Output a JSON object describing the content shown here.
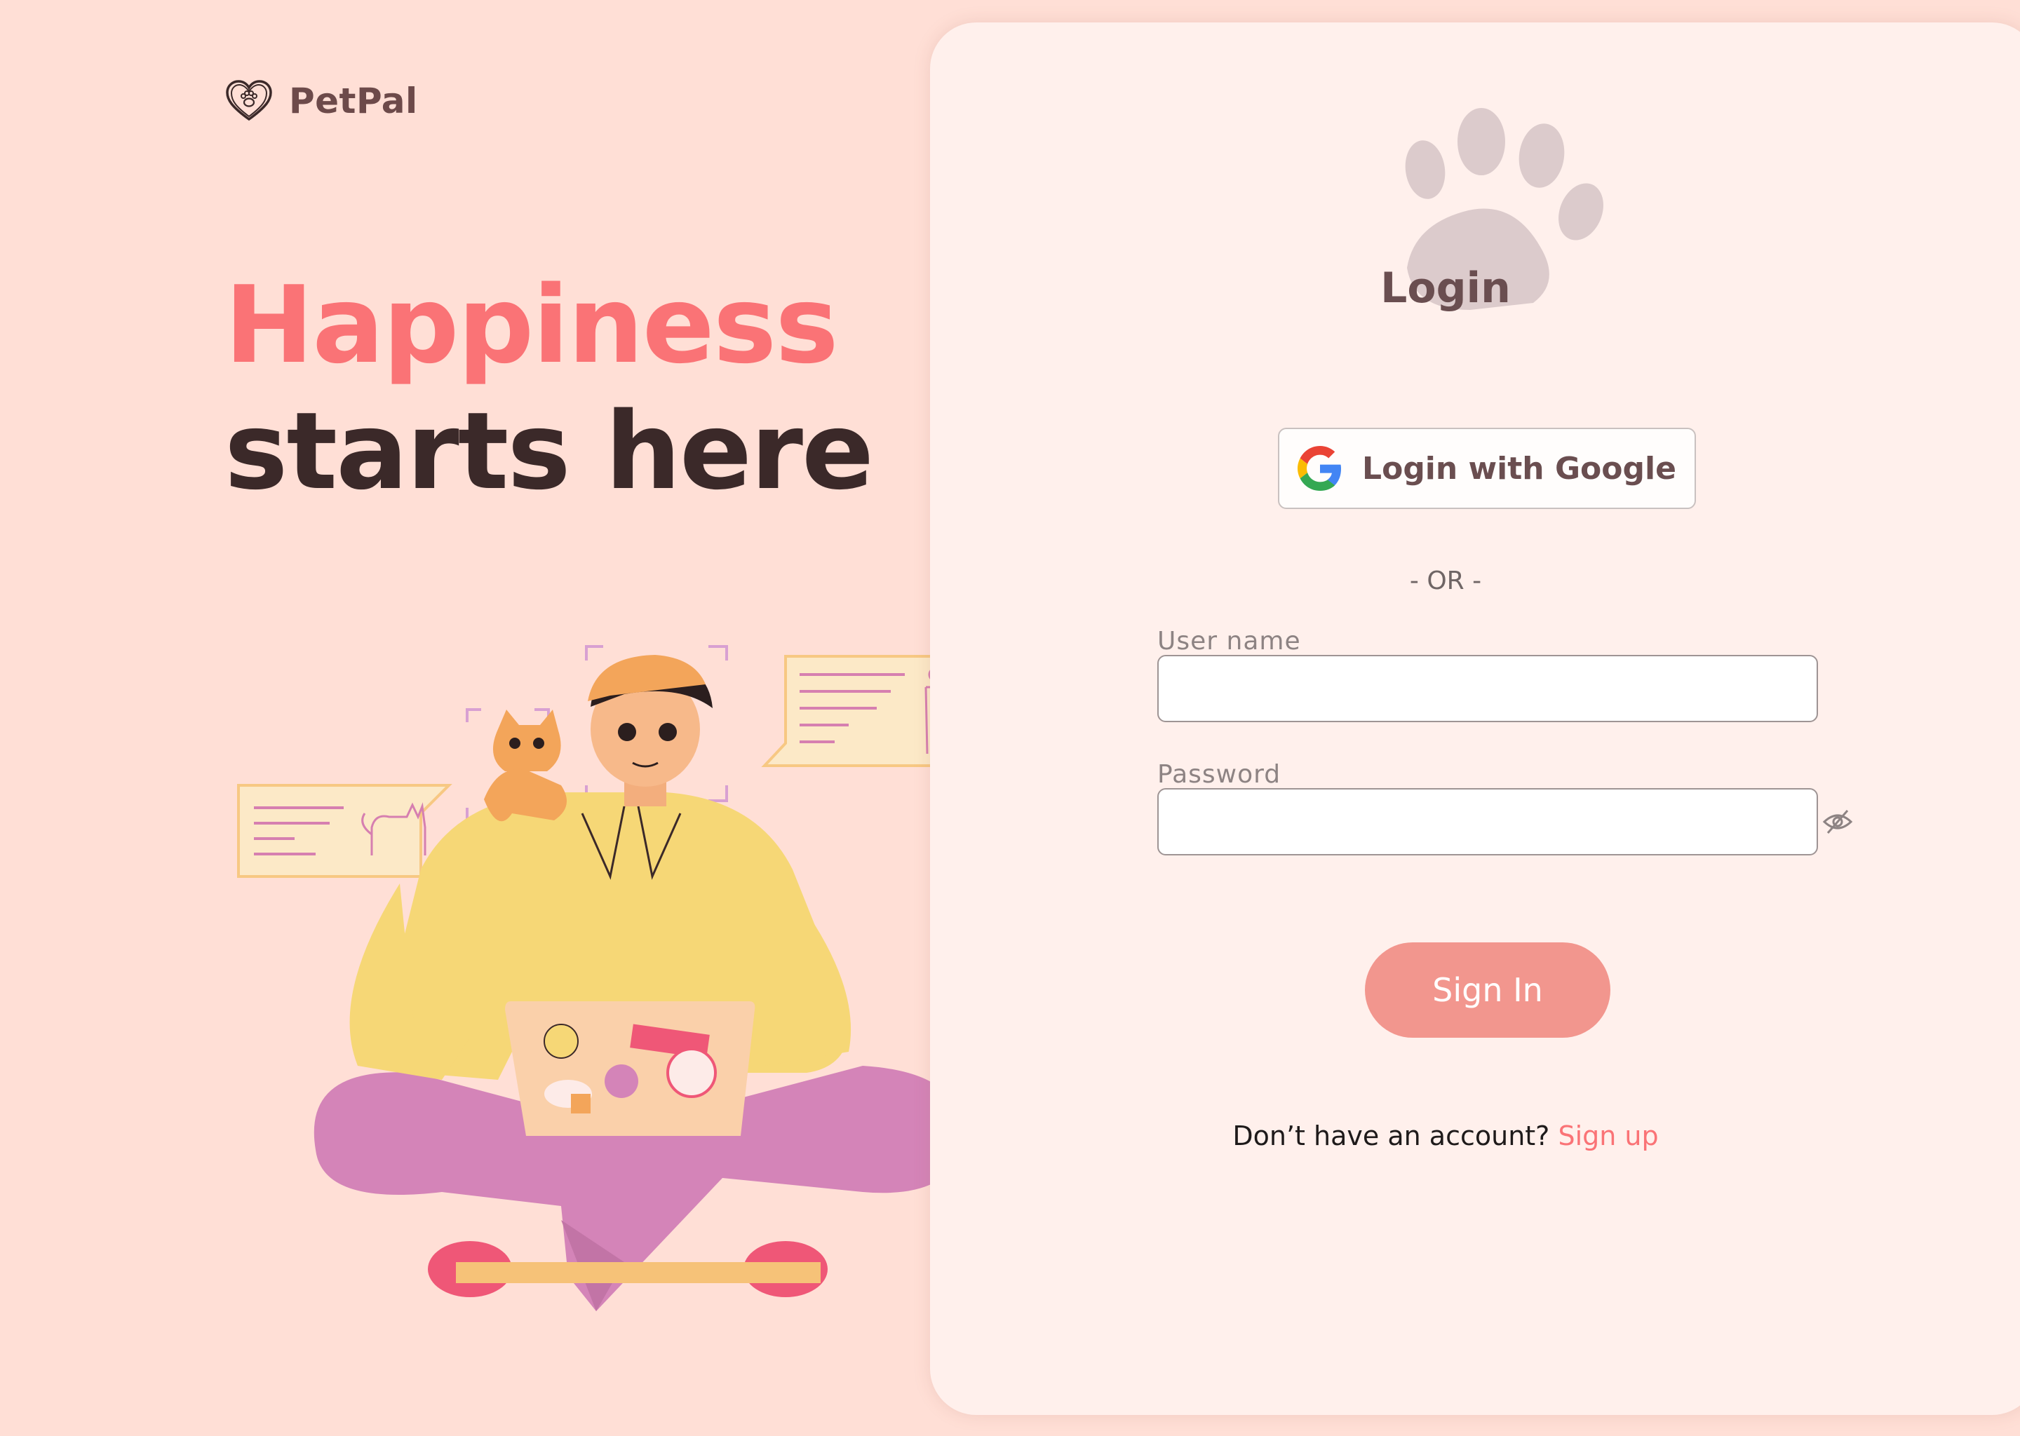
{
  "brand": {
    "name": "PetPal"
  },
  "hero": {
    "line1": "Happiness",
    "line2": "starts here"
  },
  "login": {
    "title": "Login",
    "google_label": "Login with Google",
    "or_label": "- OR -",
    "username_label": "User name",
    "username_value": "",
    "password_label": "Password",
    "password_value": "",
    "sign_in_label": "Sign In",
    "no_account_text": "Don’t have an account?",
    "sign_up_label": "Sign up"
  },
  "icons": {
    "brand": "heart-paw-icon",
    "header": "paw-icon",
    "google": "google-icon",
    "password_visibility": "eye-slash-icon"
  },
  "colors": {
    "page_background": "#ffdfd6",
    "card_background": "#fff0ec",
    "accent": "#fa7376",
    "button": "#f2968e",
    "heading_dark": "#3b2929"
  }
}
